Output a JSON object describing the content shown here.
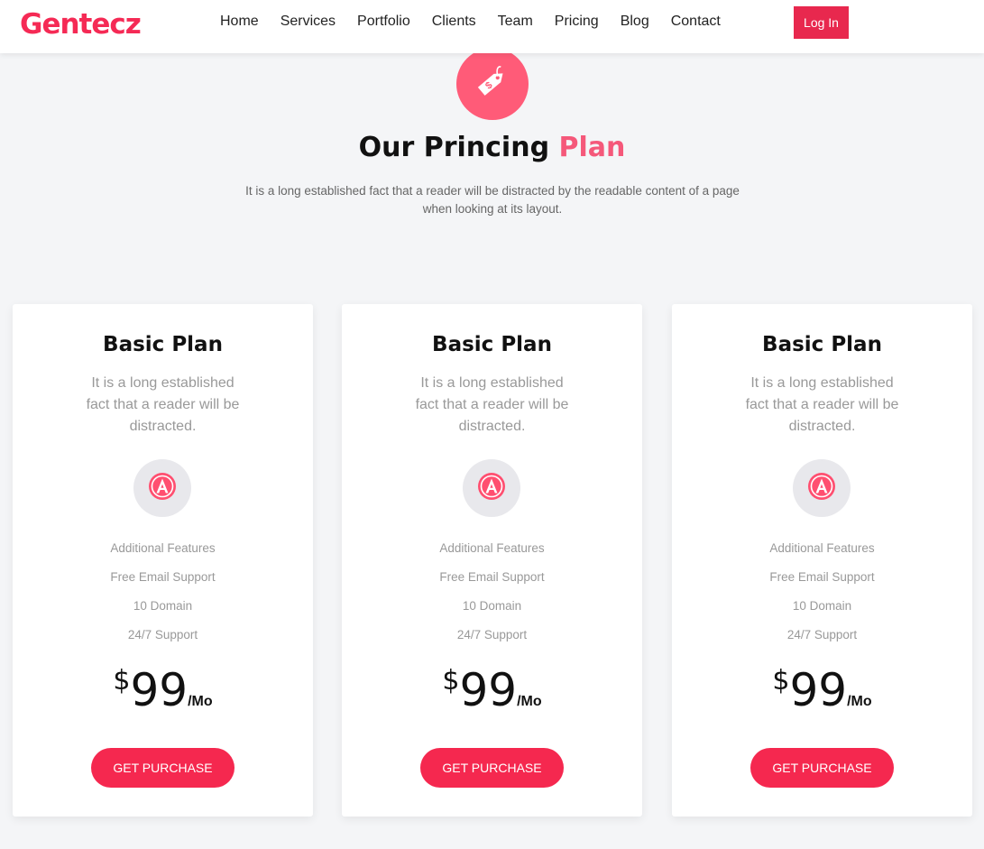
{
  "brand": {
    "logo_text": "Gentecz"
  },
  "nav": {
    "items": [
      {
        "label": "Home"
      },
      {
        "label": "Services"
      },
      {
        "label": "Portfolio"
      },
      {
        "label": "Clients"
      },
      {
        "label": "Team"
      },
      {
        "label": "Pricing"
      },
      {
        "label": "Blog"
      },
      {
        "label": "Contact"
      }
    ],
    "login_label": "Log In"
  },
  "section": {
    "icon": "price-tag-icon",
    "title_main": "Our Princing ",
    "title_accent": "Plan",
    "description": "It is a long established fact that a reader will be distracted by the readable content of a page when looking at its layout."
  },
  "plans": [
    {
      "name": "Basic Plan",
      "description": "It is a long established fact that a reader will be distracted.",
      "icon": "angular-logo-icon",
      "features": [
        "Additional Features",
        "Free Email Support",
        "10 Domain",
        "24/7 Support"
      ],
      "currency": "$",
      "price": "99",
      "period": "/Mo",
      "button_label": "GET PURCHASE"
    },
    {
      "name": "Basic Plan",
      "description": "It is a long established fact that a reader will be distracted.",
      "icon": "angular-logo-icon",
      "features": [
        "Additional Features",
        "Free Email Support",
        "10 Domain",
        "24/7 Support"
      ],
      "currency": "$",
      "price": "99",
      "period": "/Mo",
      "button_label": "GET PURCHASE"
    },
    {
      "name": "Basic Plan",
      "description": "It is a long established fact that a reader will be distracted.",
      "icon": "angular-logo-icon",
      "features": [
        "Additional Features",
        "Free Email Support",
        "10 Domain",
        "24/7 Support"
      ],
      "currency": "$",
      "price": "99",
      "period": "/Mo",
      "button_label": "GET PURCHASE"
    }
  ],
  "colors": {
    "brand": "#f52a55",
    "accent": "#f5587a",
    "button": "#f5284f",
    "background": "#f4f5f7"
  }
}
